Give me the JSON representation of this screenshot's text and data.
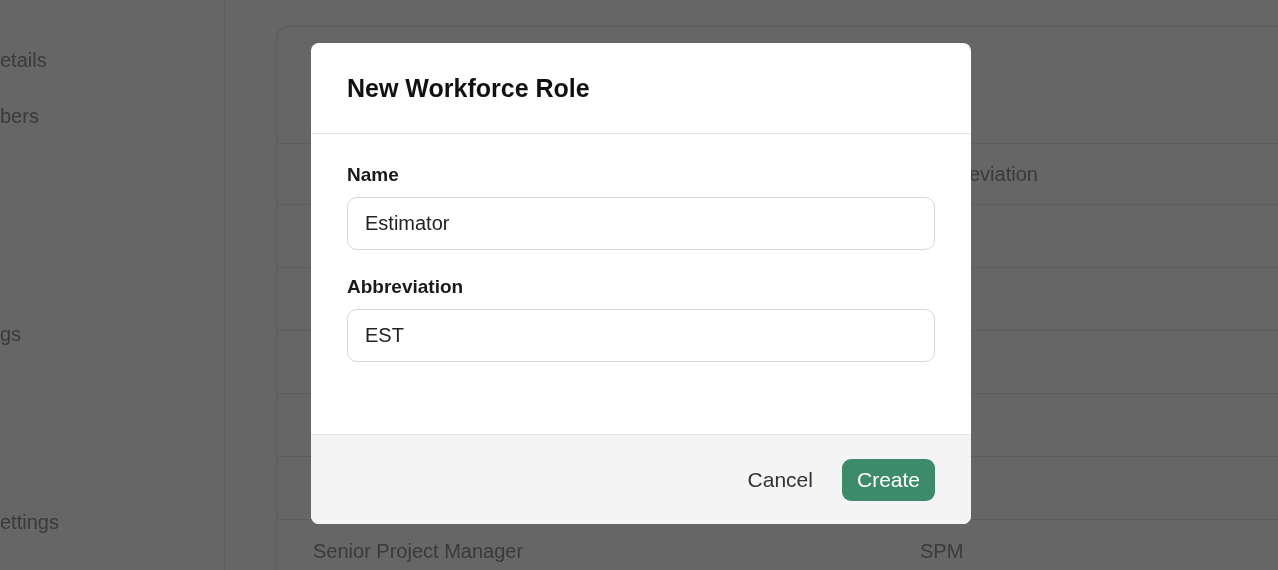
{
  "sidebar": {
    "items": [
      "etails",
      "bers",
      "gs",
      "ettings"
    ]
  },
  "table": {
    "columns": [
      "eviation"
    ],
    "rows": [
      {
        "name": "Senior Project Manager",
        "abbreviation": "SPM"
      }
    ]
  },
  "dialog": {
    "title": "New Workforce Role",
    "fields": [
      {
        "label": "Name",
        "value": "Estimator"
      },
      {
        "label": "Abbreviation",
        "value": "EST"
      }
    ],
    "buttons": [
      {
        "label": "Cancel",
        "kind": "secondary"
      },
      {
        "label": "Create",
        "kind": "primary"
      }
    ]
  }
}
